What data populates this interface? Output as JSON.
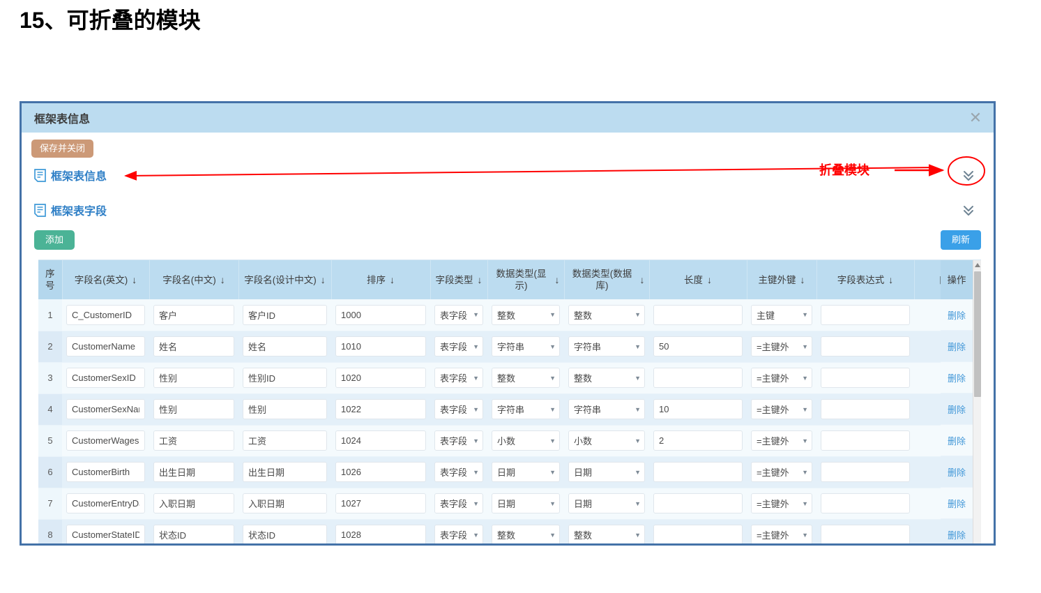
{
  "slide": {
    "title": "15、可折叠的模块"
  },
  "window": {
    "title": "框架表信息",
    "close_icon": "close-icon"
  },
  "toolbar": {
    "save_close_label": "保存并关闭"
  },
  "sections": [
    {
      "label": "框架表信息",
      "icon": "document-icon",
      "chevron": "chevron-double-down-icon"
    },
    {
      "label": "框架表字段",
      "icon": "document-icon",
      "chevron": "chevron-double-down-icon"
    }
  ],
  "grid_toolbar": {
    "add_label": "添加",
    "refresh_label": "刷新"
  },
  "grid": {
    "columns": [
      {
        "key": "seq",
        "label": "序号",
        "sortable": false
      },
      {
        "key": "name_en",
        "label": "字段名(英文)",
        "sortable": true
      },
      {
        "key": "name_cn",
        "label": "字段名(中文)",
        "sortable": true
      },
      {
        "key": "name_design",
        "label": "字段名(设计中文)",
        "sortable": true
      },
      {
        "key": "order",
        "label": "排序",
        "sortable": true
      },
      {
        "key": "field_type",
        "label": "字段类型",
        "sortable": true
      },
      {
        "key": "data_disp",
        "label": "数据类型(显示)",
        "sortable": true
      },
      {
        "key": "data_db",
        "label": "数据类型(数据库)",
        "sortable": true
      },
      {
        "key": "length",
        "label": "长度",
        "sortable": true
      },
      {
        "key": "pk_fk",
        "label": "主键外键",
        "sortable": true
      },
      {
        "key": "expression",
        "label": "字段表达式",
        "sortable": true
      },
      {
        "key": "cut_off",
        "label": "自",
        "sortable": false
      }
    ],
    "op_column_label": "操作",
    "op_action_label": "删除",
    "sort_arrow": "↓",
    "rows": [
      {
        "seq": "1",
        "name_en": "C_CustomerID",
        "name_cn": "客户",
        "name_design": "客户ID",
        "order": "1000",
        "field_type": "表字段",
        "data_disp": "整数",
        "data_db": "整数",
        "length": "",
        "pk_fk": "主键",
        "expression": ""
      },
      {
        "seq": "2",
        "name_en": "CustomerName",
        "name_cn": "姓名",
        "name_design": "姓名",
        "order": "1010",
        "field_type": "表字段",
        "data_disp": "字符串",
        "data_db": "字符串",
        "length": "50",
        "pk_fk": "=主键外",
        "expression": ""
      },
      {
        "seq": "3",
        "name_en": "CustomerSexID",
        "name_cn": "性别",
        "name_design": "性别ID",
        "order": "1020",
        "field_type": "表字段",
        "data_disp": "整数",
        "data_db": "整数",
        "length": "",
        "pk_fk": "=主键外",
        "expression": ""
      },
      {
        "seq": "4",
        "name_en": "CustomerSexNam",
        "name_cn": "性别",
        "name_design": "性别",
        "order": "1022",
        "field_type": "表字段",
        "data_disp": "字符串",
        "data_db": "字符串",
        "length": "10",
        "pk_fk": "=主键外",
        "expression": ""
      },
      {
        "seq": "5",
        "name_en": "CustomerWages",
        "name_cn": "工资",
        "name_design": "工资",
        "order": "1024",
        "field_type": "表字段",
        "data_disp": "小数",
        "data_db": "小数",
        "length": "2",
        "pk_fk": "=主键外",
        "expression": ""
      },
      {
        "seq": "6",
        "name_en": "CustomerBirth",
        "name_cn": "出生日期",
        "name_design": "出生日期",
        "order": "1026",
        "field_type": "表字段",
        "data_disp": "日期",
        "data_db": "日期",
        "length": "",
        "pk_fk": "=主键外",
        "expression": ""
      },
      {
        "seq": "7",
        "name_en": "CustomerEntryDat",
        "name_cn": "入职日期",
        "name_design": "入职日期",
        "order": "1027",
        "field_type": "表字段",
        "data_disp": "日期",
        "data_db": "日期",
        "length": "",
        "pk_fk": "=主键外",
        "expression": ""
      },
      {
        "seq": "8",
        "name_en": "CustomerStateID",
        "name_cn": "状态ID",
        "name_design": "状态ID",
        "order": "1028",
        "field_type": "表字段",
        "data_disp": "整数",
        "data_db": "整数",
        "length": "",
        "pk_fk": "=主键外",
        "expression": ""
      }
    ]
  },
  "annotation": {
    "label": "折叠模块",
    "color": "#ff0000"
  },
  "colors": {
    "window_border": "#4472a8",
    "header_bg": "#bcdcf0",
    "section_link": "#2f7fc6",
    "save_button": "#cc9977",
    "add_button": "#4bb396",
    "refresh_button": "#3aa0e8",
    "delete_link": "#4398d8",
    "annotation_red": "#ff0000"
  }
}
